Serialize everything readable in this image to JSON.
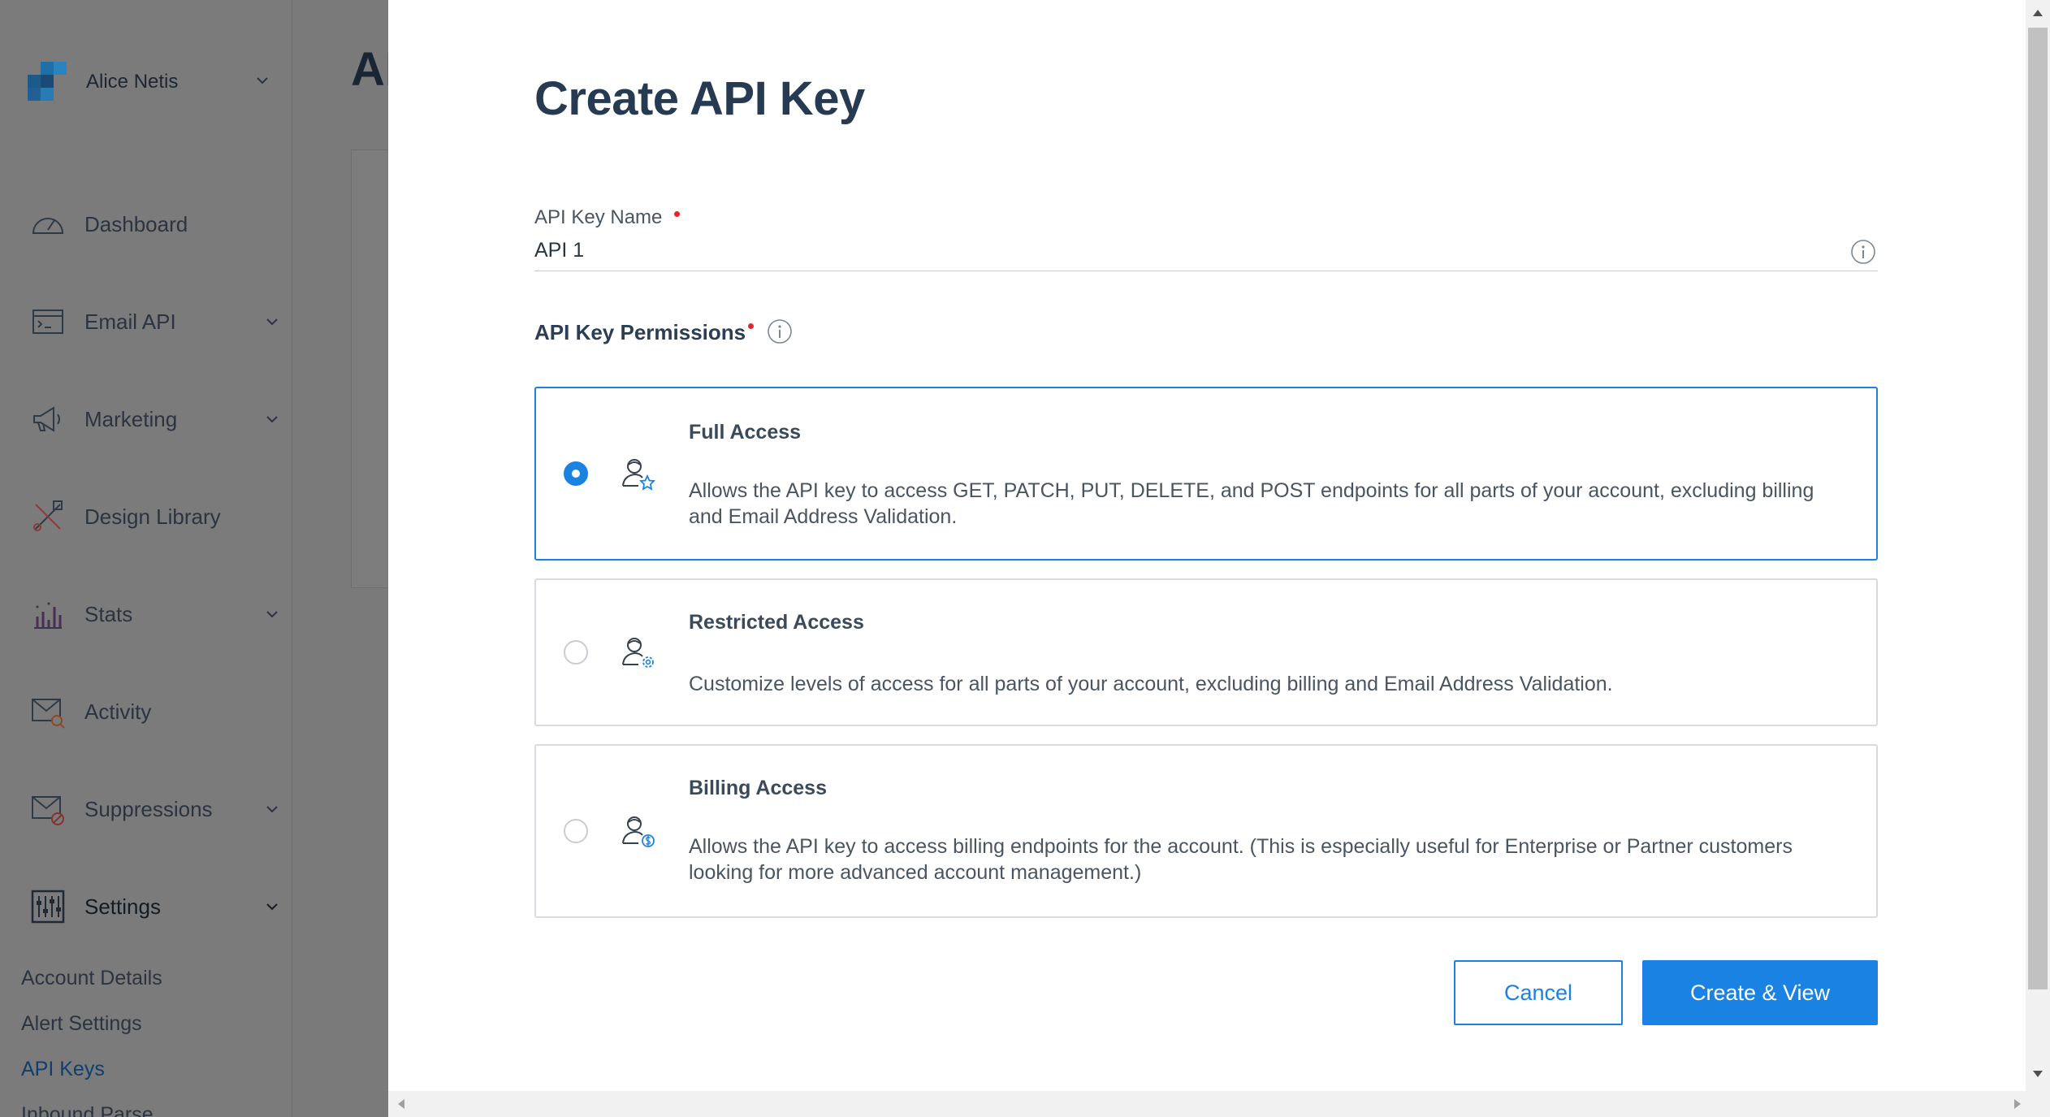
{
  "sidebar": {
    "account_name": "Alice Netis",
    "items": [
      {
        "label": "Dashboard",
        "icon": "gauge-icon",
        "has_chevron": false
      },
      {
        "label": "Email API",
        "icon": "terminal-icon",
        "has_chevron": true
      },
      {
        "label": "Marketing",
        "icon": "megaphone-icon",
        "has_chevron": true
      },
      {
        "label": "Design Library",
        "icon": "design-tools-icon",
        "has_chevron": false
      },
      {
        "label": "Stats",
        "icon": "bar-chart-icon",
        "has_chevron": true
      },
      {
        "label": "Activity",
        "icon": "envelope-search-icon",
        "has_chevron": false
      },
      {
        "label": "Suppressions",
        "icon": "envelope-block-icon",
        "has_chevron": true
      },
      {
        "label": "Settings",
        "icon": "sliders-icon",
        "has_chevron": true
      }
    ],
    "settings_subitems": [
      "Account Details",
      "Alert Settings",
      "API Keys",
      "Inbound Parse"
    ],
    "active_subitem": "API Keys"
  },
  "background_page": {
    "title_fragment": "AI"
  },
  "modal": {
    "title": "Create API Key",
    "name_field": {
      "label": "API Key Name",
      "value": "API 1",
      "required": true
    },
    "permissions": {
      "label": "API Key Permissions",
      "required": true,
      "selected": "full_access",
      "options": [
        {
          "id": "full_access",
          "title": "Full Access",
          "description": "Allows the API key to access GET, PATCH, PUT, DELETE, and POST endpoints for all parts of your account, excluding billing and Email Address Validation.",
          "icon": "user-star-icon"
        },
        {
          "id": "restricted_access",
          "title": "Restricted Access",
          "description": "Customize levels of access for all parts of your account, excluding billing and Email Address Validation.",
          "icon": "user-gear-icon"
        },
        {
          "id": "billing_access",
          "title": "Billing Access",
          "description": "Allows the API key to access billing endpoints for the account. (This is especially useful for Enterprise or Partner customers looking for more advanced account management.)",
          "icon": "user-dollar-icon"
        }
      ]
    },
    "buttons": {
      "cancel": "Cancel",
      "create": "Create & View"
    }
  },
  "colors": {
    "accent": "#1a82e2",
    "title": "#263b52",
    "required": "#e3262b",
    "overlay": "#7a7a7a"
  }
}
